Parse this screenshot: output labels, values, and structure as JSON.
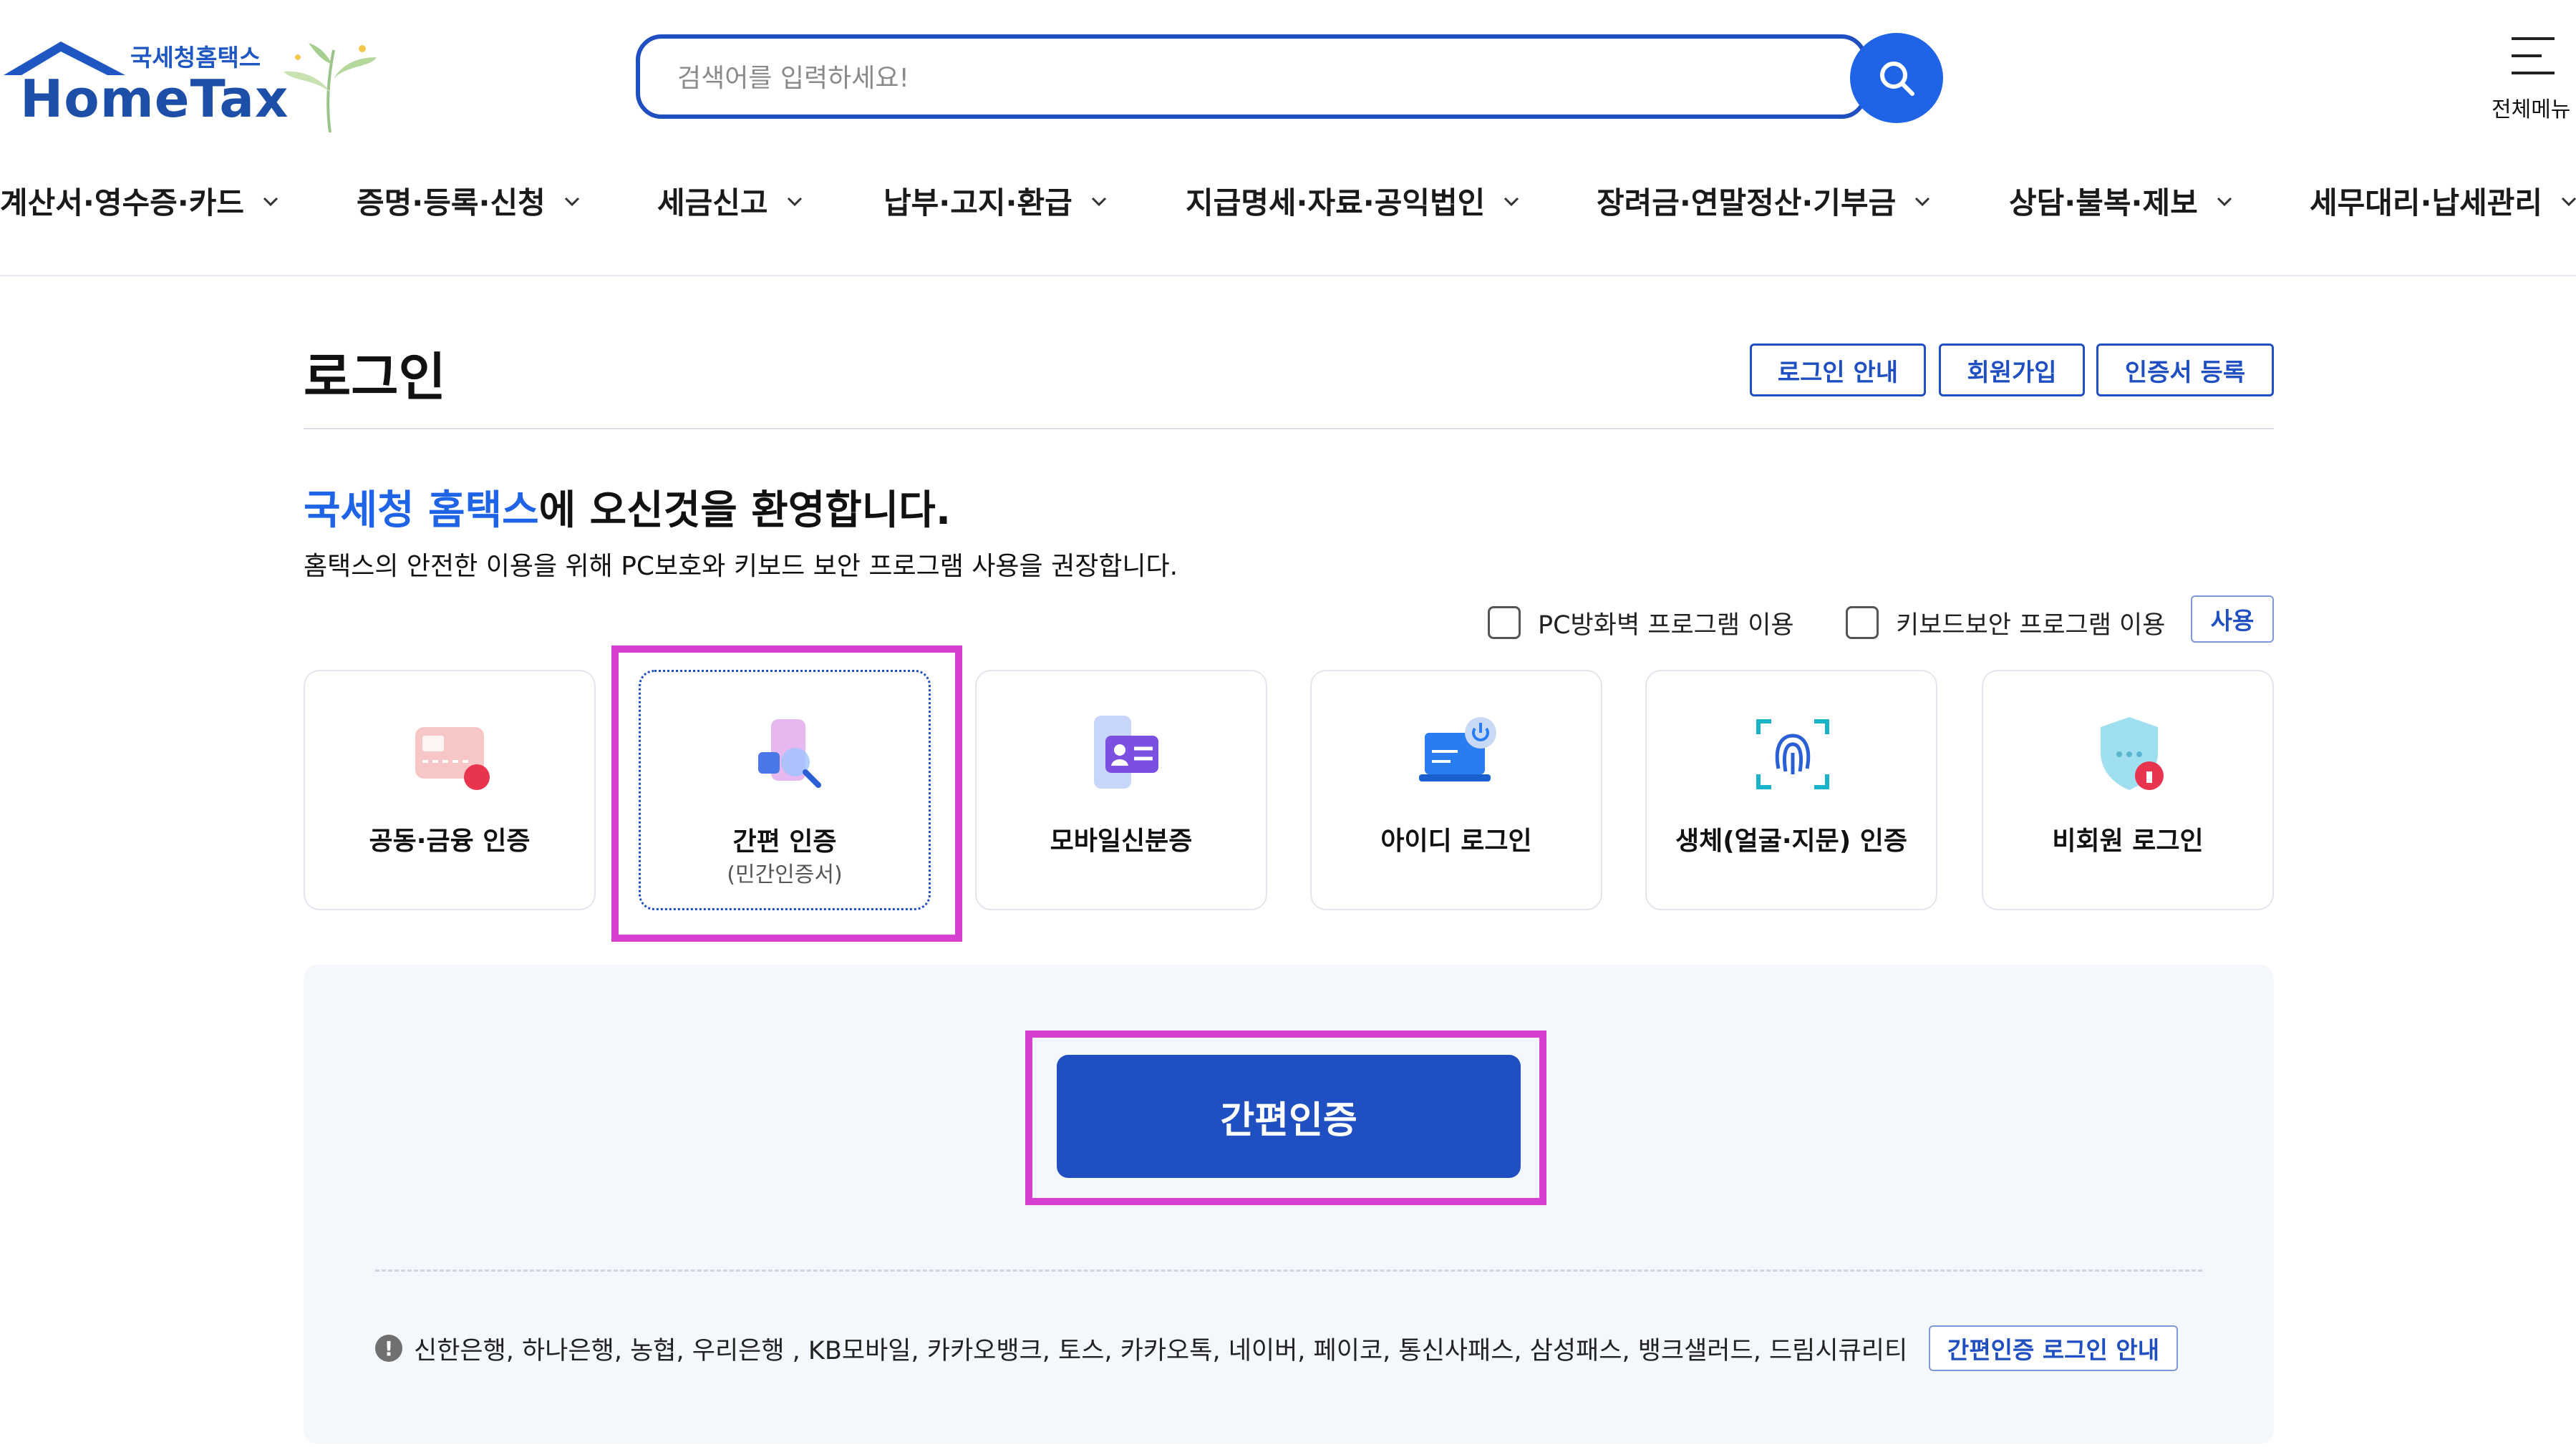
{
  "header": {
    "logo_tagline": "국세청홈택스",
    "logo_text": "HomeTax",
    "search_placeholder": "검색어를 입력하세요!",
    "menu_label": "전체메뉴"
  },
  "nav": {
    "items": [
      "계산서·영수증·카드",
      "증명·등록·신청",
      "세금신고",
      "납부·고지·환급",
      "지급명세·자료·공익법인",
      "장려금·연말정산·기부금",
      "상담·불복·제보",
      "세무대리·납세관리"
    ]
  },
  "page": {
    "title": "로그인",
    "top_buttons": [
      "로그인 안내",
      "회원가입",
      "인증서 등록"
    ],
    "welcome_brand": "국세청 홈택스",
    "welcome_rest": "에 오신것을 환영합니다.",
    "subtitle": "홈택스의 안전한 이용을 위해 PC보호와 키보드 보안 프로그램 사용을 권장합니다.",
    "options": {
      "firewall_label": "PC방화벽 프로그램 이용",
      "keyboard_label": "키보드보안 프로그램 이용",
      "use_button": "사용"
    }
  },
  "login_methods": [
    {
      "label": "공동·금융 인증",
      "sublabel": "",
      "icon": "certificate-card-icon"
    },
    {
      "label": "간편 인증",
      "sublabel": "(민간인증서)",
      "icon": "simple-auth-search-icon",
      "selected": true
    },
    {
      "label": "모바일신분증",
      "sublabel": "",
      "icon": "mobile-id-icon"
    },
    {
      "label": "아이디 로그인",
      "sublabel": "",
      "icon": "laptop-power-icon"
    },
    {
      "label": "생체(얼굴·지문) 인증",
      "sublabel": "",
      "icon": "fingerprint-icon"
    },
    {
      "label": "비회원 로그인",
      "sublabel": "",
      "icon": "shield-lock-icon"
    }
  ],
  "panel": {
    "main_button": "간편인증",
    "providers_notice": "신한은행, 하나은행, 농협, 우리은행 , KB모바일, 카카오뱅크, 토스, 카카오톡, 네이버, 페이코, 통신사패스, 삼성패스, 뱅크샐러드, 드림시큐리티",
    "guide_button": "간편인증 로그인 안내"
  },
  "colors": {
    "brand_blue": "#1f4fc0",
    "accent_blue": "#1f64e6",
    "highlight_magenta": "#d63fd0",
    "panel_bg": "#f4f7fc"
  }
}
